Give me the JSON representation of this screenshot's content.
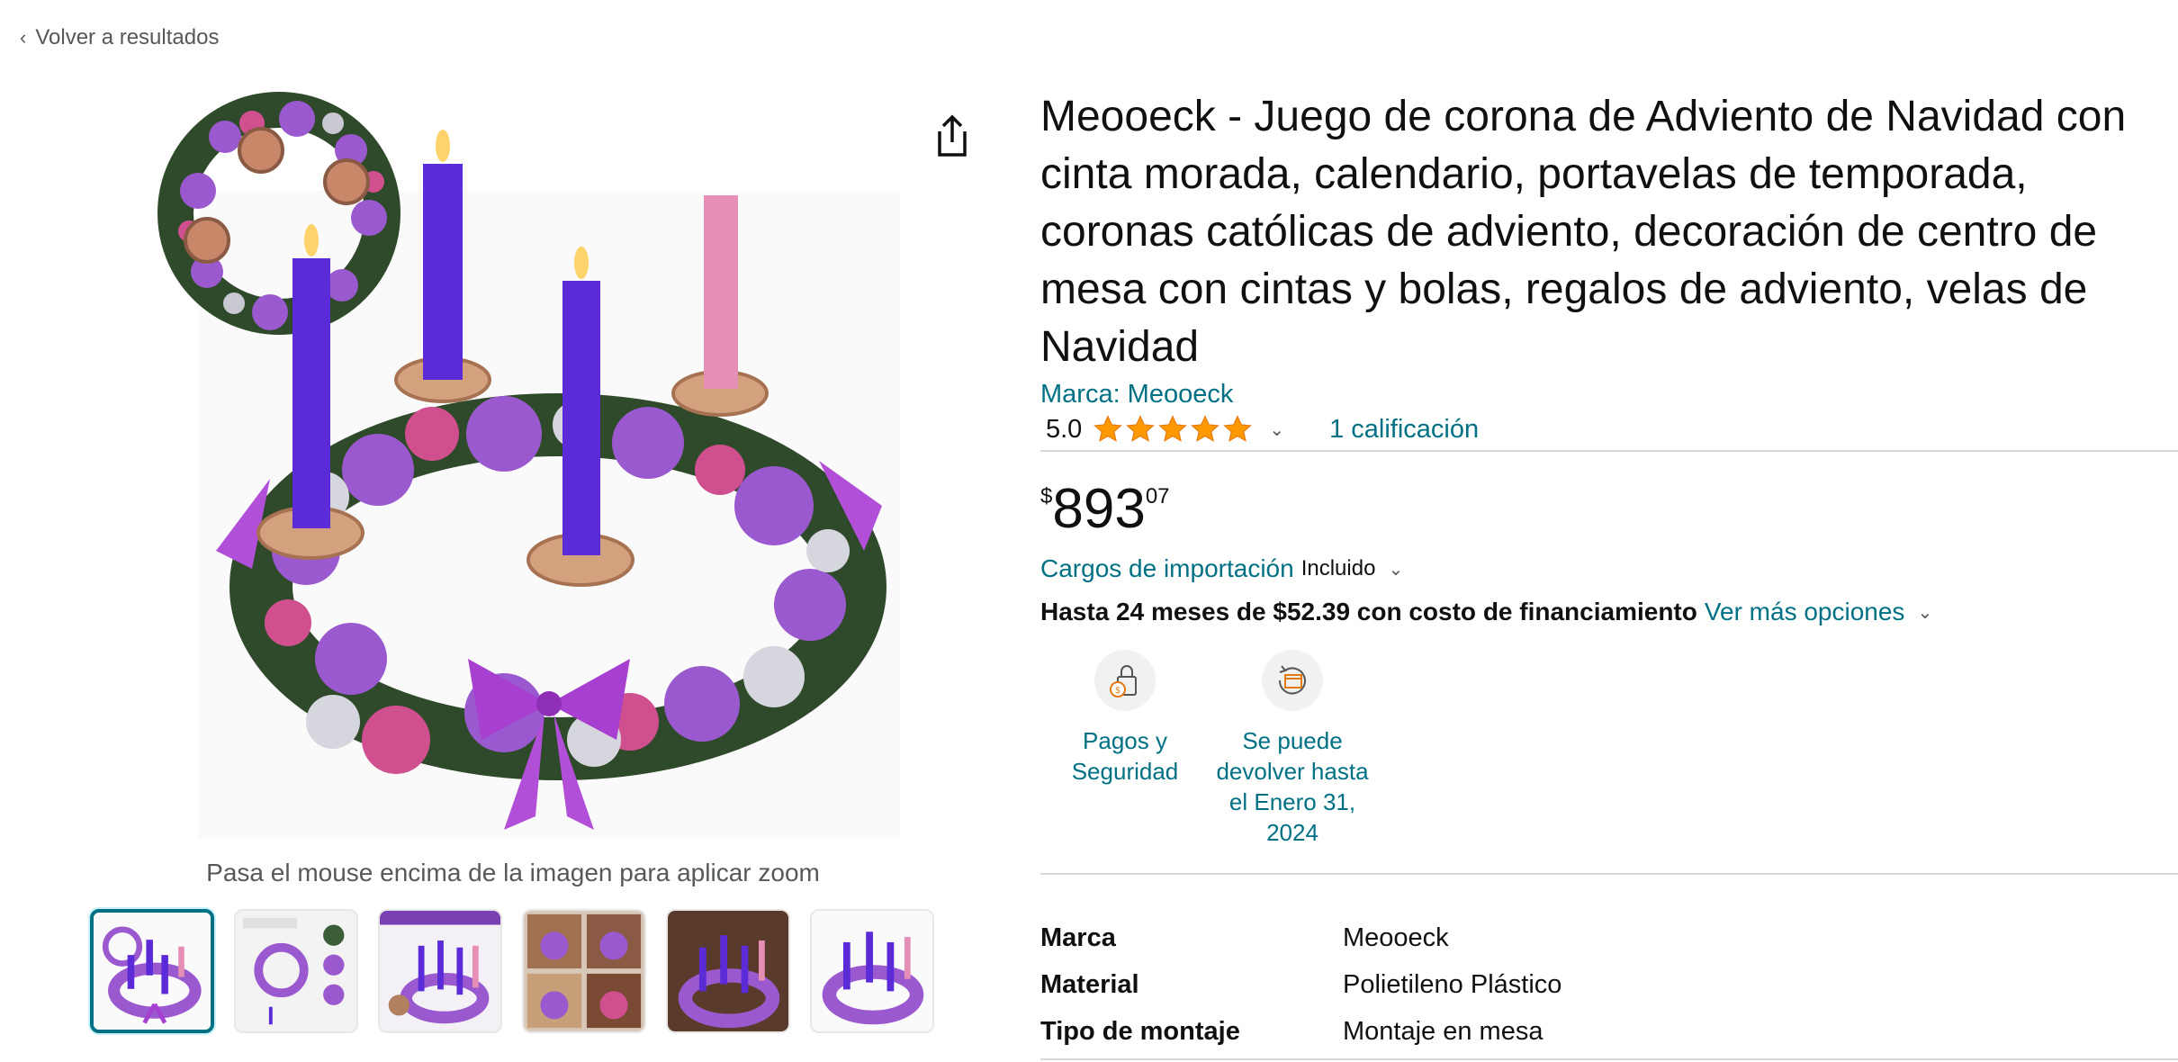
{
  "nav": {
    "back_label": "Volver a resultados"
  },
  "gallery": {
    "zoom_hint": "Pasa el mouse encima de la imagen para aplicar zoom",
    "thumb_count": 6,
    "active_index": 0
  },
  "product": {
    "title": "Meooeck - Juego de corona de Adviento de Navidad con cinta morada, calendario, portavelas de temporada, coronas católicas de adviento, decoración de centro de mesa con cintas y bolas, regalos de adviento, velas de Navidad",
    "brand": "Marca: Meooeck",
    "rating_value": "5.0",
    "rating_stars": 5,
    "ratings_count": "1 calificación"
  },
  "price": {
    "symbol": "$",
    "whole": "893",
    "fraction": "07"
  },
  "import": {
    "label": "Cargos de importación",
    "value": "Incluido"
  },
  "financing": {
    "text": "Hasta 24 meses de $52.39 con costo de financiamiento",
    "link": "Ver más opciones"
  },
  "features": [
    {
      "icon": "secure-payment-icon",
      "label": "Pagos y Seguridad"
    },
    {
      "icon": "returns-icon",
      "label": "Se puede devolver hasta el Enero 31, 2024"
    }
  ],
  "specs": [
    {
      "key": "Marca",
      "value": "Meooeck"
    },
    {
      "key": "Material",
      "value": "Polietileno Plástico"
    },
    {
      "key": "Tipo de montaje",
      "value": "Montaje en mesa"
    }
  ],
  "colors": {
    "link": "#007185",
    "star": "#ff9900",
    "candle_purple": "#5a2bd6",
    "candle_pink": "#e58fb6",
    "ornament_purple": "#9b59d0",
    "ornament_pink": "#d04f8f"
  }
}
